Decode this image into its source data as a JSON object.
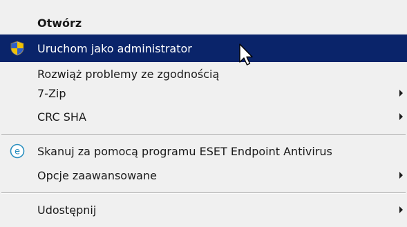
{
  "menu": {
    "items": [
      {
        "label": "Otwórz",
        "bold": true,
        "submenu": false
      },
      {
        "label": "Uruchom jako administrator",
        "highlighted": true,
        "icon": "uac-shield-icon",
        "submenu": false
      },
      {
        "label": "Rozwiąż problemy ze zgodnością",
        "submenu": false
      },
      {
        "label": "7-Zip",
        "submenu": true
      },
      {
        "label": "CRC SHA",
        "submenu": true
      },
      {
        "label": "Skanuj za pomocą programu ESET Endpoint Antivirus",
        "icon": "eset-icon",
        "submenu": false
      },
      {
        "label": "Opcje zaawansowane",
        "submenu": true
      },
      {
        "label": "Udostępnij",
        "submenu": true
      }
    ]
  },
  "colors": {
    "menu_bg": "#f0f0f0",
    "highlight_bg": "#0a246a",
    "highlight_text": "#ffffff",
    "eset_icon": "#2a8fbf"
  }
}
